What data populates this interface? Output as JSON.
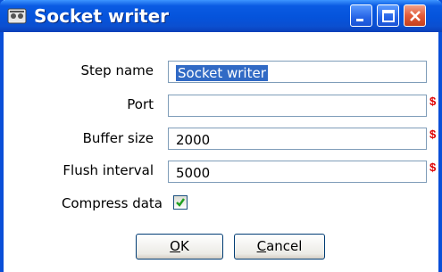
{
  "window": {
    "title": "Socket writer",
    "app_icon": "hop-icon"
  },
  "form": {
    "step_name": {
      "label": "Step name",
      "value": "Socket writer"
    },
    "port": {
      "label": "Port",
      "value": ""
    },
    "buffer_size": {
      "label": "Buffer size",
      "value": "2000"
    },
    "flush_interval": {
      "label": "Flush interval",
      "value": "5000"
    },
    "compress": {
      "label": "Compress data",
      "checked": true
    }
  },
  "buttons": {
    "ok": {
      "mnemonic": "O",
      "rest": "K"
    },
    "cancel": {
      "mnemonic": "C",
      "rest": "ancel"
    }
  },
  "colors": {
    "titlebar": "#0553db",
    "variable_marker": "#e00000",
    "selection": "#316ac5"
  }
}
